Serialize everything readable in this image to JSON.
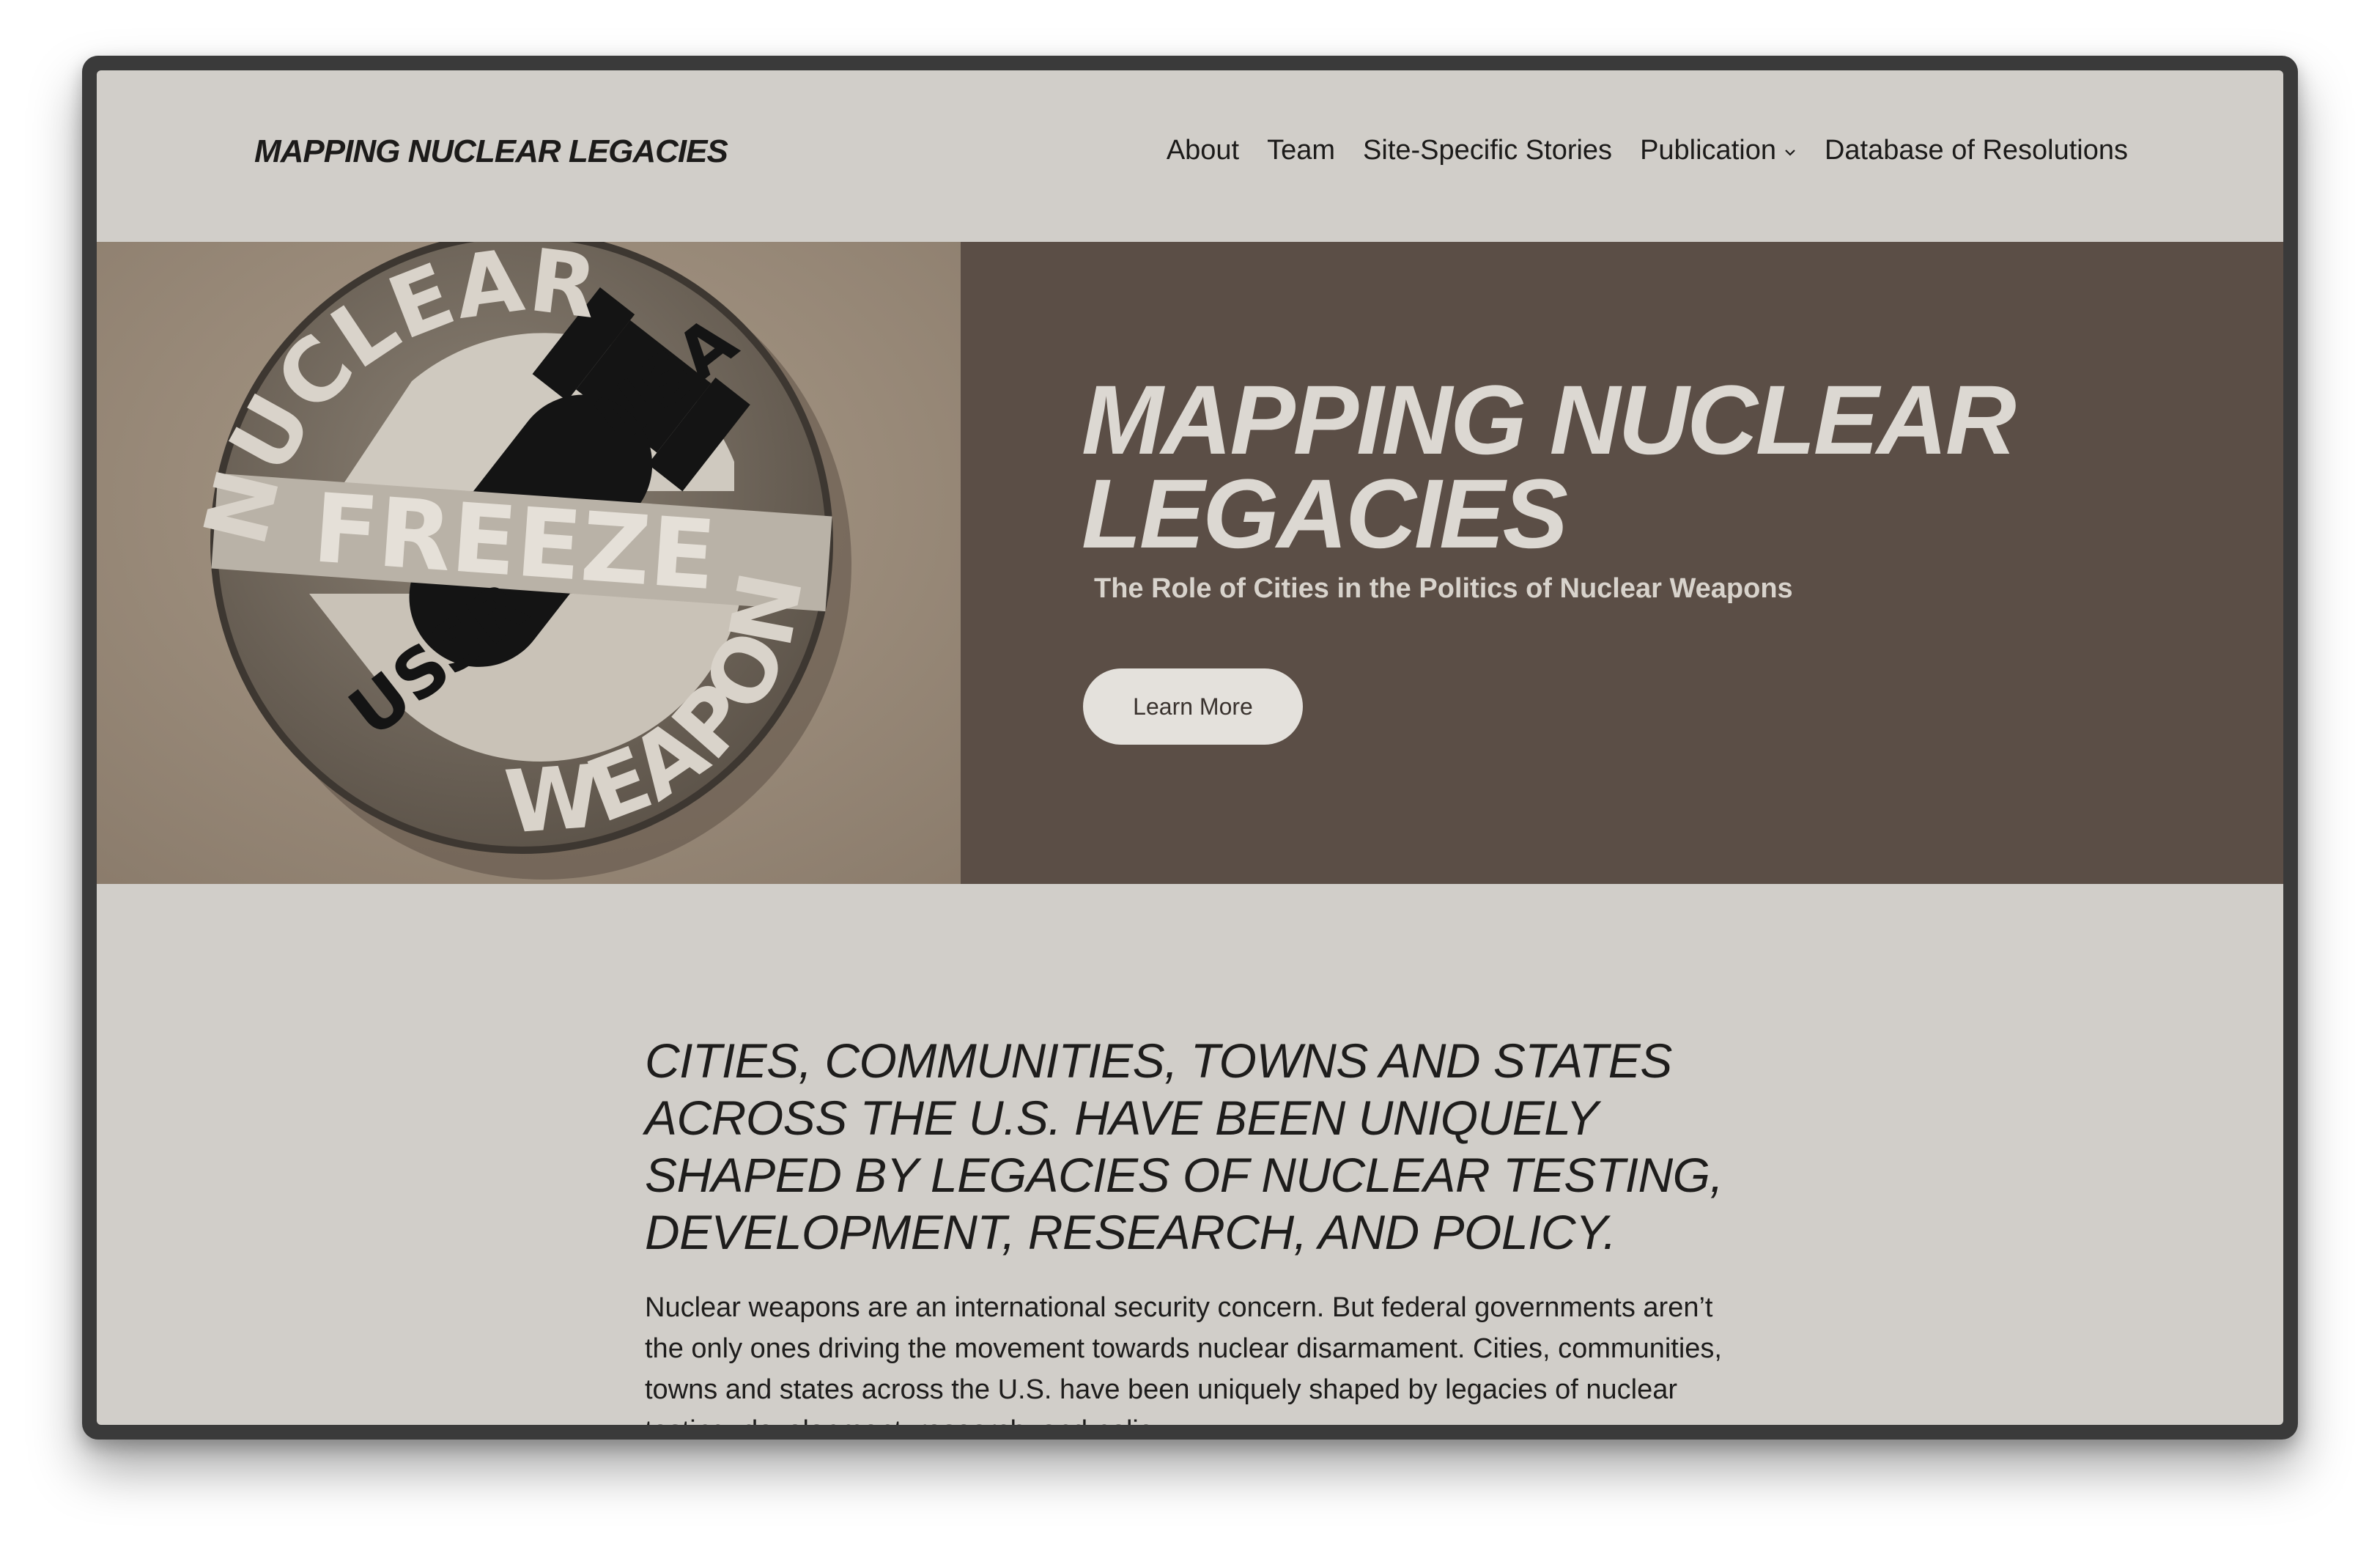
{
  "header": {
    "site_title": "MAPPING NUCLEAR LEGACIES",
    "nav": [
      {
        "label": "About"
      },
      {
        "label": "Team"
      },
      {
        "label": "Site-Specific Stories"
      },
      {
        "label": "Publication",
        "has_dropdown": true
      },
      {
        "label": "Database of Resolutions"
      }
    ]
  },
  "hero": {
    "image_badge_text": [
      "NUCLEAR",
      "FREEZE",
      "USA",
      "USSR",
      "WEAPONS"
    ],
    "title": "MAPPING NUCLEAR LEGACIES",
    "subtitle": "The Role of Cities in the Politics of Nuclear Weapons",
    "button_label": "Learn More"
  },
  "content": {
    "lead": "Cities, communities, towns and states across the U.S. have been uniquely shaped by legacies of nuclear testing, development, research, and policy.",
    "paragraph": "Nuclear weapons are an international security concern. But federal governments aren’t the only ones driving the movement towards nuclear disarmament. Cities, communities, towns and states across the U.S. have been uniquely shaped by legacies of nuclear testing, development, research, and policy."
  },
  "colors": {
    "page_bg": "#d1cec9",
    "hero_panel": "#5b4e46",
    "hero_text": "#dcd8d2",
    "button_bg": "#e4e1dc",
    "text": "#1c1b1a"
  },
  "icons": [
    "chevron-down-icon"
  ]
}
